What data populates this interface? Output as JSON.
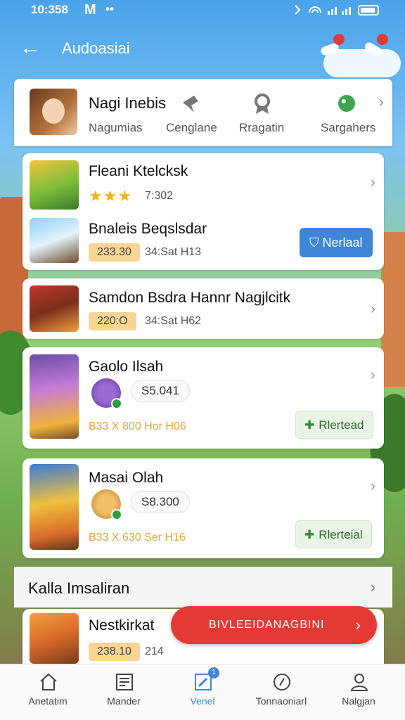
{
  "status_bar": {
    "time": "10:358",
    "carrier": "M",
    "dots": "••"
  },
  "header": {
    "title": "Audoasiai"
  },
  "profile": {
    "name": "Nagi Inebis",
    "tabs": [
      "Nagumias",
      "Cenglane",
      "Rragatin",
      "Sargahers"
    ]
  },
  "cards": [
    {
      "items": [
        {
          "title": "Fleani Ktelcksk",
          "rating_text": "7:302"
        },
        {
          "title": "Bnaleis Beqslsdar",
          "pill": "233.30",
          "meta": "34:Sat H13",
          "button": "Nerlaal"
        }
      ]
    },
    {
      "title": "Samdon Bsdra Hannr Nagjlcitk",
      "pill": "220:O",
      "meta": "34:Sat H62"
    },
    {
      "title": "Gaolo Ilsah",
      "price": "S5.041",
      "orange_meta": "B33 X 800 Hor H06",
      "button": "Rlertead"
    },
    {
      "title": "Masai Olah",
      "price": "S8.300",
      "orange_meta": "B33 X 630 Ser H16",
      "button": "Rlerteial"
    }
  ],
  "section": {
    "title": "Kalla Imsaliran"
  },
  "last_card": {
    "title": "Nestkirkat",
    "pill": "238.10",
    "meta": "214"
  },
  "cta": {
    "label": "BIVLEEIDANAGBINI"
  },
  "nav": [
    {
      "label": "Anetatim",
      "icon": "home-icon"
    },
    {
      "label": "Mander",
      "icon": "news-icon"
    },
    {
      "label": "Venel",
      "icon": "edit-icon",
      "badge": "1"
    },
    {
      "label": "Tonnaoniarl",
      "icon": "refresh-icon"
    },
    {
      "label": "Nalgjan",
      "icon": "user-icon"
    }
  ],
  "colors": {
    "accent": "#3d86d8",
    "cta": "#e53935",
    "pill": "#f6d595",
    "star": "#f2b11a"
  }
}
